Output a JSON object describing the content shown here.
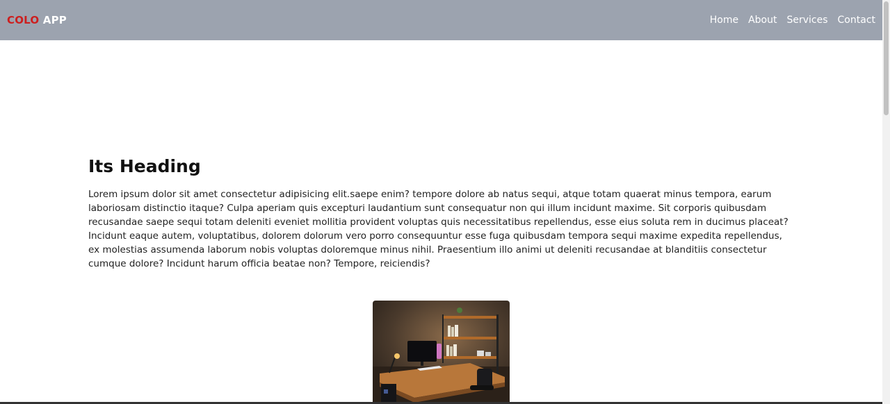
{
  "navbar": {
    "brand_part1": "COLO",
    "brand_part2": "APP",
    "links": [
      "Home",
      "About",
      "Services",
      "Contact"
    ]
  },
  "main": {
    "heading": "Its Heading",
    "paragraph": "Lorem ipsum dolor sit amet consectetur adipisicing elit.saepe enim? tempore dolore ab natus sequi, atque totam quaerat minus tempora, earum laboriosam distinctio itaque? Culpa aperiam quis excepturi laudantium sunt consequatur non qui illum incidunt maxime. Sit corporis quibusdam recusandae saepe sequi totam deleniti eveniet mollitia provident voluptas quis necessitatibus repellendus, esse eius soluta rem in ducimus placeat? Incidunt eaque autem, voluptatibus, dolorem dolorum vero porro consequuntur esse fuga quibusdam tempora sequi maxime expedita repellendus, ex molestias assumenda laborum nobis voluptas doloremque minus nihil. Praesentium illo animi ut deleniti recusandae at blanditiis consectetur cumque dolore? Incidunt harum officia beatae non? Tempore, reiciendis?"
  },
  "colors": {
    "navbar_bg": "#9ca3af",
    "brand_accent": "#cc1f1f",
    "nav_text": "#ffffff"
  }
}
